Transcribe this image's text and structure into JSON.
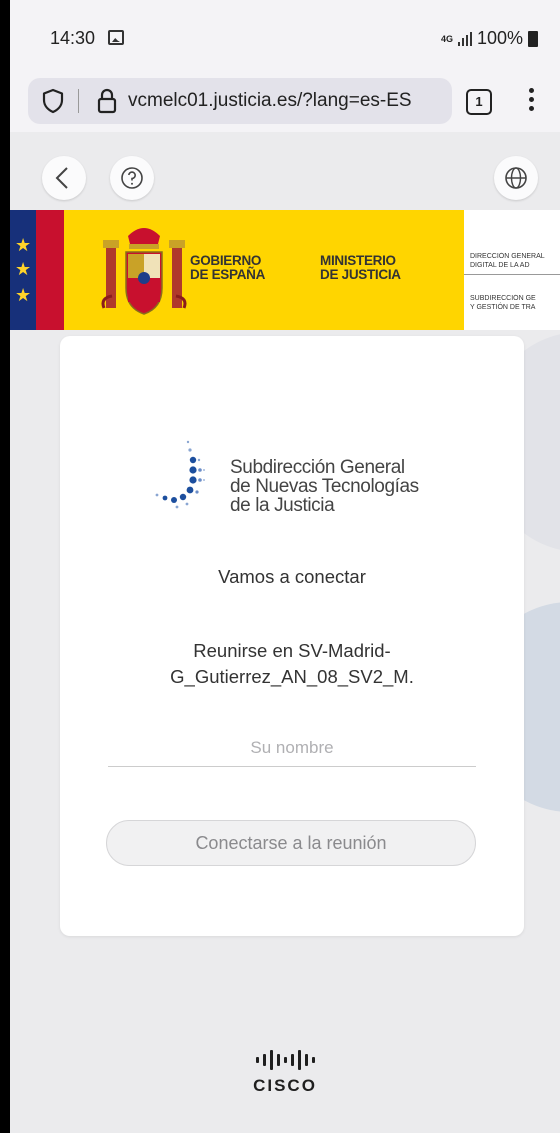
{
  "status_bar": {
    "time": "14:30",
    "network": "4G",
    "battery": "100%"
  },
  "browser": {
    "url": "vcmelc01.justicia.es/?lang=es-ES",
    "tab_count": "1"
  },
  "banner": {
    "gobierno_line1": "GOBIERNO",
    "gobierno_line2": "DE ESPAÑA",
    "ministerio_line1": "MINISTERIO",
    "ministerio_line2": "DE JUSTICIA",
    "direccion_line1": "DIRECCIÓN GENERAL",
    "direccion_line2": "DIGITAL DE LA AD",
    "subdireccion_line1": "SUBDIRECCIÓN GE",
    "subdireccion_line2": "Y GESTIÓN DE TRA"
  },
  "card": {
    "logo_line1": "Subdirección General",
    "logo_line2": "de Nuevas Tecnologías",
    "logo_line3": "de la Justicia",
    "connect_text": "Vamos a conectar",
    "meeting_line1": "Reunirse en SV-Madrid-",
    "meeting_line2": "G_Gutierrez_AN_08_SV2_M.",
    "name_placeholder": "Su nombre",
    "join_button": "Conectarse a la reunión"
  },
  "footer": {
    "brand": "CISCO"
  },
  "colors": {
    "eu_blue": "#17307a",
    "spain_red": "#c8102e",
    "gov_yellow": "#ffd500",
    "logo_blue": "#1d4f9e"
  }
}
